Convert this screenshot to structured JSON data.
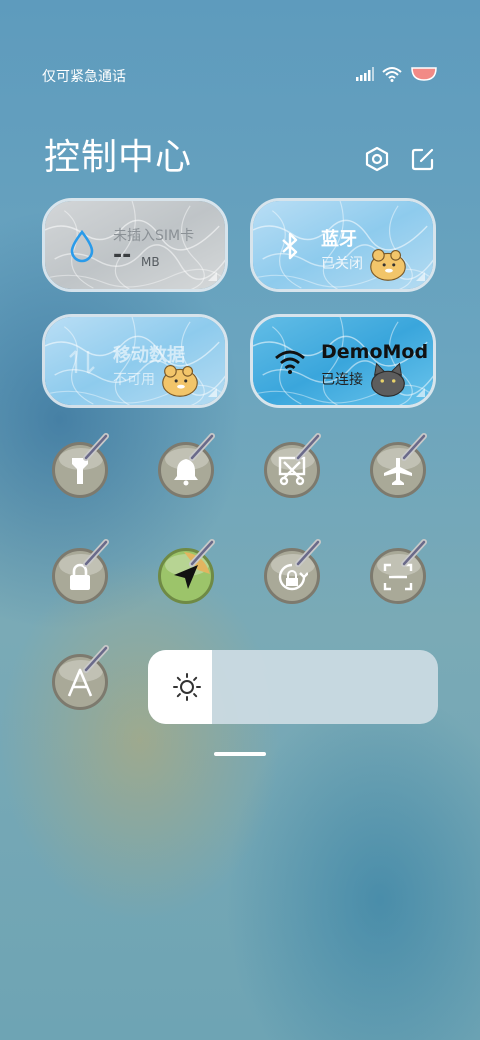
{
  "status_bar": {
    "carrier": "仅可紧急通话",
    "battery_color": "#f28a86"
  },
  "header": {
    "title": "控制中心",
    "settings_icon": "hexagon-settings-icon",
    "edit_icon": "edit-icon"
  },
  "tiles": {
    "data": {
      "title": "未插入SIM卡",
      "value": "--",
      "unit": "MB",
      "icon": "water-drop-icon"
    },
    "bluetooth": {
      "title": "蓝牙",
      "status": "已关闭",
      "icon": "bluetooth-icon",
      "mascot": "hamster-icon"
    },
    "mobile_data": {
      "title": "移动数据",
      "status": "不可用",
      "icon": "mobile-data-icon",
      "mascot": "hamster-icon"
    },
    "wifi": {
      "title": "DemoMod",
      "status": "已连接",
      "icon": "wifi-icon",
      "mascot": "cat-icon"
    }
  },
  "toggles": [
    {
      "name": "flashlight",
      "icon": "flashlight-icon",
      "active": false
    },
    {
      "name": "ringer",
      "icon": "bell-icon",
      "active": false
    },
    {
      "name": "screenshot",
      "icon": "scissors-icon",
      "active": false
    },
    {
      "name": "airplane-mode",
      "icon": "airplane-icon",
      "active": false
    },
    {
      "name": "lock-screen",
      "icon": "lock-icon",
      "active": false
    },
    {
      "name": "location",
      "icon": "location-arrow-icon",
      "active": true
    },
    {
      "name": "auto-rotate",
      "icon": "rotation-lock-icon",
      "active": false
    },
    {
      "name": "scanner",
      "icon": "scan-icon",
      "active": false
    },
    {
      "name": "auto-brightness",
      "icon": "auto-brightness-icon",
      "active": false
    }
  ],
  "brightness": {
    "level": 0.22,
    "icon": "sun-icon"
  },
  "colors": {
    "tile_water": "#9fd0ee",
    "tile_gray": "#c5cacd",
    "toggle_disc": "#a9a998",
    "location_active": "#9cc46a"
  }
}
